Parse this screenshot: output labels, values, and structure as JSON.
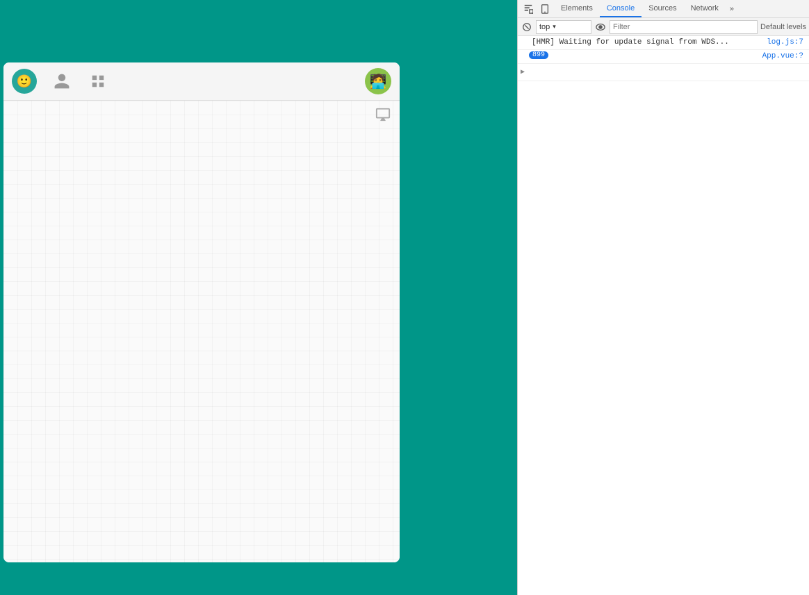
{
  "app": {
    "bg_color": "#009688"
  },
  "chat_header": {
    "emoji": "🙂",
    "avatar_emoji": "🧑‍💻"
  },
  "devtools": {
    "tabs": [
      {
        "label": "Elements",
        "active": false
      },
      {
        "label": "Console",
        "active": true
      },
      {
        "label": "Sources",
        "active": false
      },
      {
        "label": "Network",
        "active": false
      }
    ],
    "more_label": "»",
    "console_toolbar": {
      "context_value": "top",
      "filter_placeholder": "Filter",
      "default_levels_label": "Default levels"
    },
    "console_rows": [
      {
        "content": "[HMR] Waiting for update signal from WDS...",
        "source": "log.js:7",
        "count": null
      },
      {
        "content": "899",
        "source": "App.vue:?",
        "count": null
      }
    ]
  }
}
